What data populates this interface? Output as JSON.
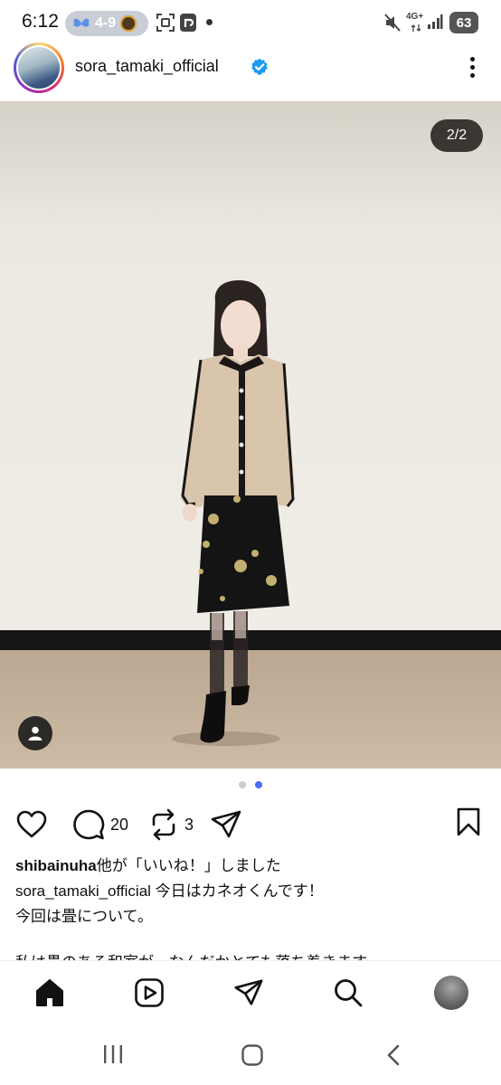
{
  "status_bar": {
    "time": "6:12",
    "pill_text": "4-9",
    "network": "4G+",
    "battery": "63"
  },
  "post": {
    "username": "sora_tamaki_official",
    "verified": true,
    "image_counter": "2/2",
    "carousel": {
      "count": 2,
      "active_index": 1
    },
    "comments_count": "20",
    "reposts_count": "3",
    "liked_by": "shibainuha",
    "liked_suffix": "他が「いいね！」しました",
    "caption_author": "sora_tamaki_official",
    "caption_line1": " 今日はカネオくんです！",
    "caption_line2": "今回は畳について。",
    "caption_line3_partial": "私は畳のある和室が、なんだかとても落ち着きます"
  },
  "colors": {
    "accent_blue": "#4a6cf7",
    "verified_blue": "#1a9bf0",
    "dot_inactive": "#c8cdd6"
  },
  "icons": {
    "like": "heart-icon",
    "comment": "comment-icon",
    "repost": "repost-icon",
    "share": "send-icon",
    "save": "bookmark-icon",
    "home": "home-icon",
    "reels": "reels-icon",
    "dm": "send-icon",
    "search": "search-icon",
    "profile": "profile-avatar"
  }
}
